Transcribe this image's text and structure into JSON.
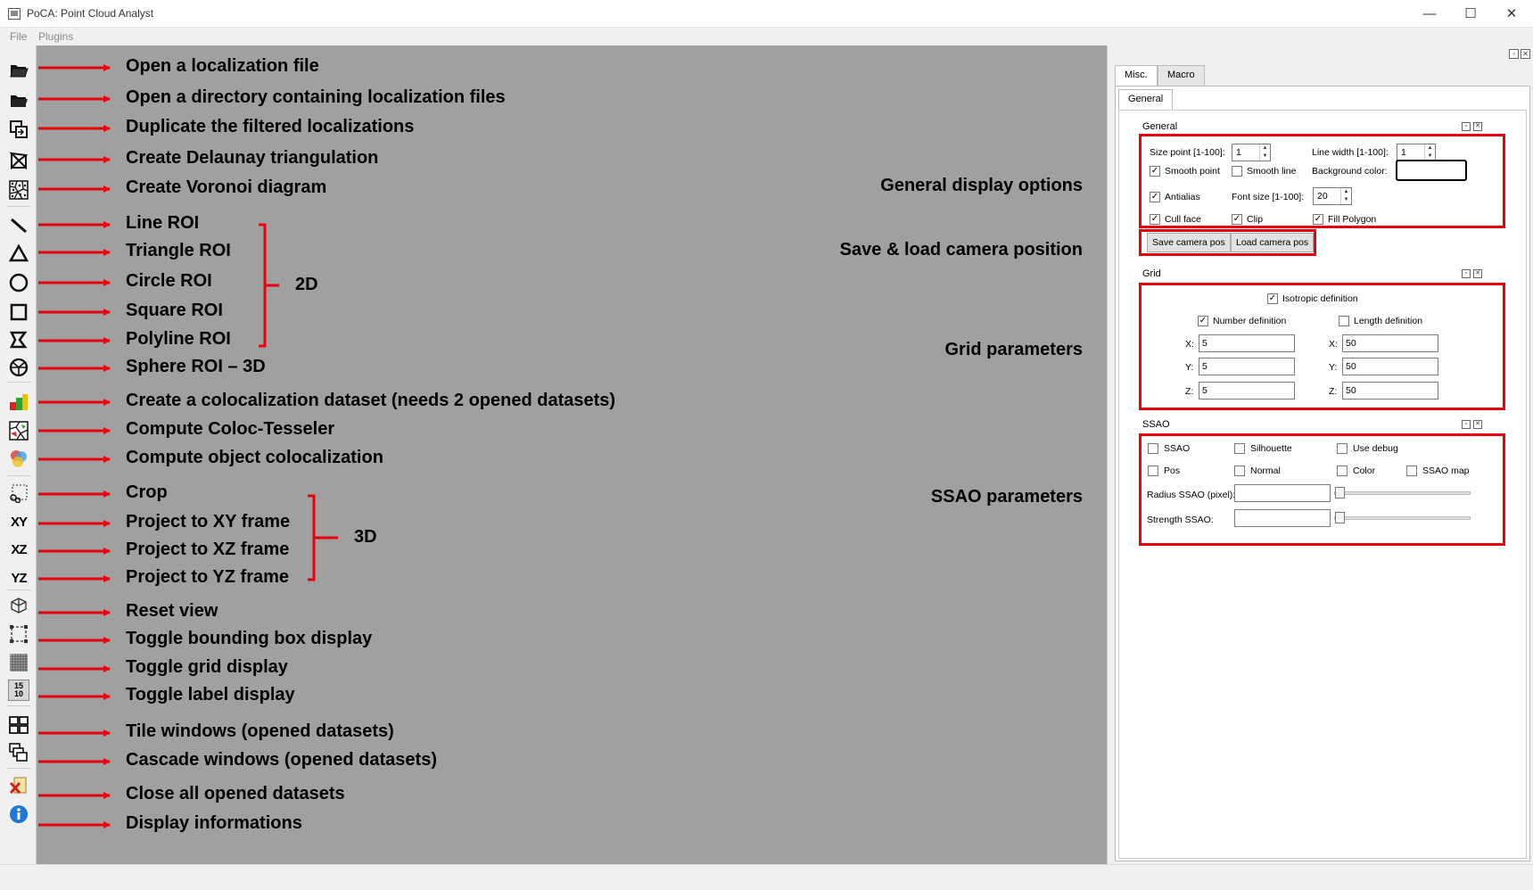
{
  "window": {
    "title": "PoCA: Point Cloud Analyst",
    "minimize_glyph": "—",
    "maximize_glyph": "☐",
    "close_glyph": "✕"
  },
  "menu": {
    "file": "File",
    "plugins": "Plugins"
  },
  "toolbar_annotations": [
    "Open a localization file",
    "Open a directory containing localization files",
    "Duplicate the filtered localizations",
    "Create Delaunay triangulation",
    "Create Voronoi diagram",
    "Line ROI",
    "Triangle ROI",
    "Circle ROI",
    "Square ROI",
    "Polyline ROI",
    "Sphere ROI – 3D",
    "Create a colocalization dataset (needs 2 opened datasets)",
    "Compute Coloc-Tesseler",
    "Compute object colocalization",
    "Crop",
    "Project to XY frame",
    "Project to XZ frame",
    "Project to YZ frame",
    "Reset view",
    "Toggle bounding box display",
    "Toggle grid display",
    "Toggle label display",
    "Tile windows (opened datasets)",
    "Cascade windows (opened datasets)",
    "Close all opened datasets",
    "Display informations"
  ],
  "toolbar_icons": {
    "xy": "XY",
    "xz": "XZ",
    "yz": "YZ",
    "label_top": "15",
    "label_bottom": "10"
  },
  "group_labels": {
    "roi_2d": "2D",
    "projection_3d": "3D"
  },
  "panel_annotations": {
    "general": "General display options",
    "camera": "Save & load camera position",
    "grid": "Grid parameters",
    "ssao": "SSAO parameters"
  },
  "tabs": [
    "Misc.",
    "Macro"
  ],
  "subtab": "General",
  "general": {
    "title": "General",
    "size_point_label": "Size point [1-100]:",
    "size_point_value": "1",
    "line_width_label": "Line width [1-100]:",
    "line_width_value": "1",
    "smooth_point": "Smooth point",
    "smooth_line": "Smooth line",
    "background_color": "Background color:",
    "antialias": "Antialias",
    "font_size_label": "Font size [1-100]:",
    "font_size_value": "20",
    "cull_face": "Cull face",
    "clip": "Clip",
    "fill_polygon": "Fill Polygon",
    "save_camera": "Save camera pos",
    "load_camera": "Load camera pos",
    "checked_glyph": "✓"
  },
  "grid": {
    "title": "Grid",
    "isotropic": "Isotropic definition",
    "number_def": "Number definition",
    "length_def": "Length definition",
    "x_label": "X:",
    "y_label": "Y:",
    "z_label": "Z:",
    "num_x": "5",
    "num_y": "5",
    "num_z": "5",
    "len_x": "50",
    "len_y": "50",
    "len_z": "50"
  },
  "ssao": {
    "title": "SSAO",
    "ssao": "SSAO",
    "silhouette": "Silhouette",
    "use_debug": "Use debug",
    "pos": "Pos",
    "normal": "Normal",
    "color": "Color",
    "ssao_map": "SSAO map",
    "radius_label": "Radius SSAO (pixel):",
    "strength_label": "Strength SSAO:"
  }
}
